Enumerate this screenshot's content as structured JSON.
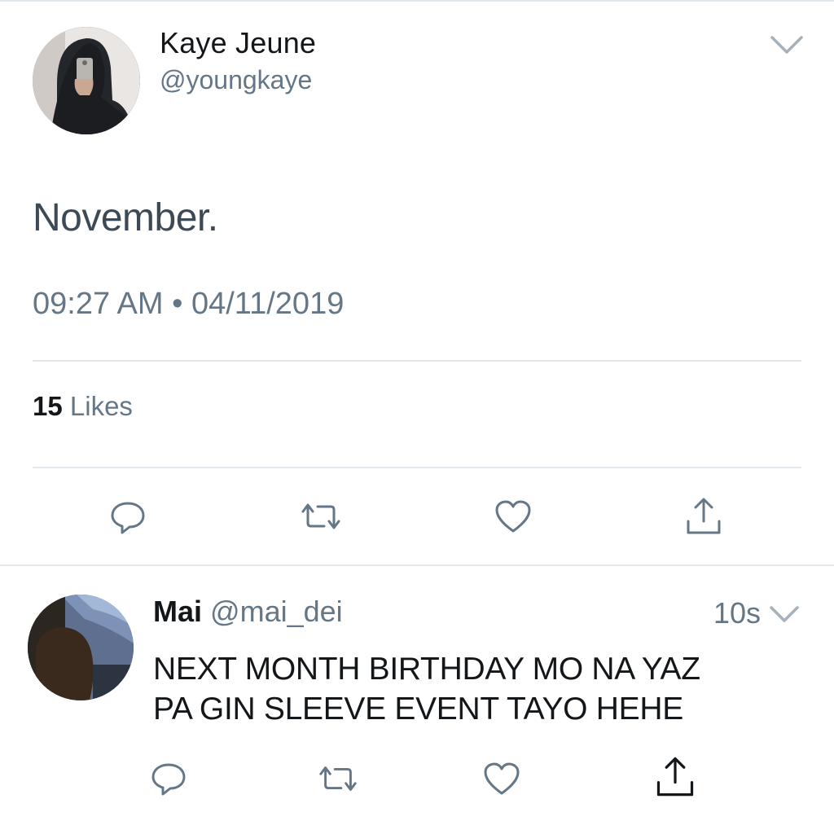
{
  "tweet": {
    "author": {
      "name": "Kaye Jeune",
      "handle": "@youngkaye"
    },
    "text": "November.",
    "timestamp": "09:27 AM • 04/11/2019",
    "likes": {
      "count": "15",
      "label": "Likes"
    },
    "actions": [
      "reply-icon",
      "retweet-icon",
      "like-icon",
      "share-icon"
    ],
    "menu_icon": "chevron-down-icon"
  },
  "reply": {
    "author": {
      "name": "Mai",
      "handle": "@mai_dei"
    },
    "time": "10s",
    "text_lines": [
      "NEXT MONTH BIRTHDAY MO NA YAZ",
      "PA GIN SLEEVE EVENT TAYO HEHE"
    ],
    "actions": [
      "reply-icon",
      "retweet-icon",
      "like-icon",
      "share-icon"
    ],
    "menu_icon": "chevron-down-icon"
  },
  "colors": {
    "text_primary": "#14171a",
    "text_secondary": "#657786",
    "divider": "#e1e8ed",
    "background": "#ffffff"
  }
}
